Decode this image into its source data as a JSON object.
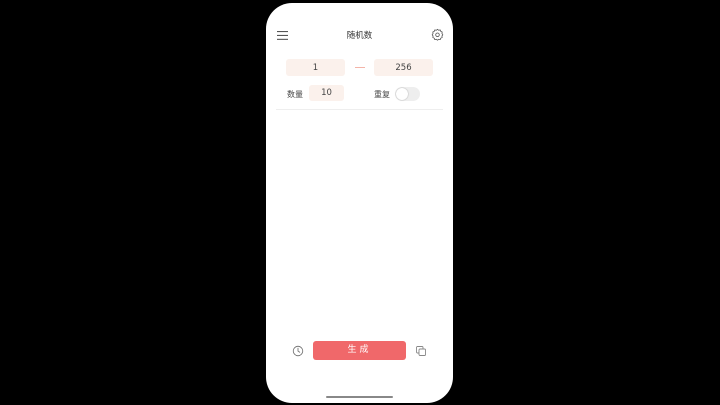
{
  "nav": {
    "title": "随机数",
    "menu_icon": "hamburger-menu-icon",
    "settings_icon": "gear-icon"
  },
  "range": {
    "min_value": "1",
    "max_value": "256",
    "separator": "—"
  },
  "options": {
    "quantity_label": "数量",
    "quantity_value": "10",
    "repeat_label": "重复",
    "repeat_enabled": false
  },
  "results": [],
  "actions": {
    "generate_label": "生成",
    "history_icon": "clock-icon",
    "copy_icon": "copy-icon"
  },
  "colors": {
    "accent": "#f0686a",
    "field_bg": "#fbf1ec",
    "separator": "#f4b4a8"
  }
}
